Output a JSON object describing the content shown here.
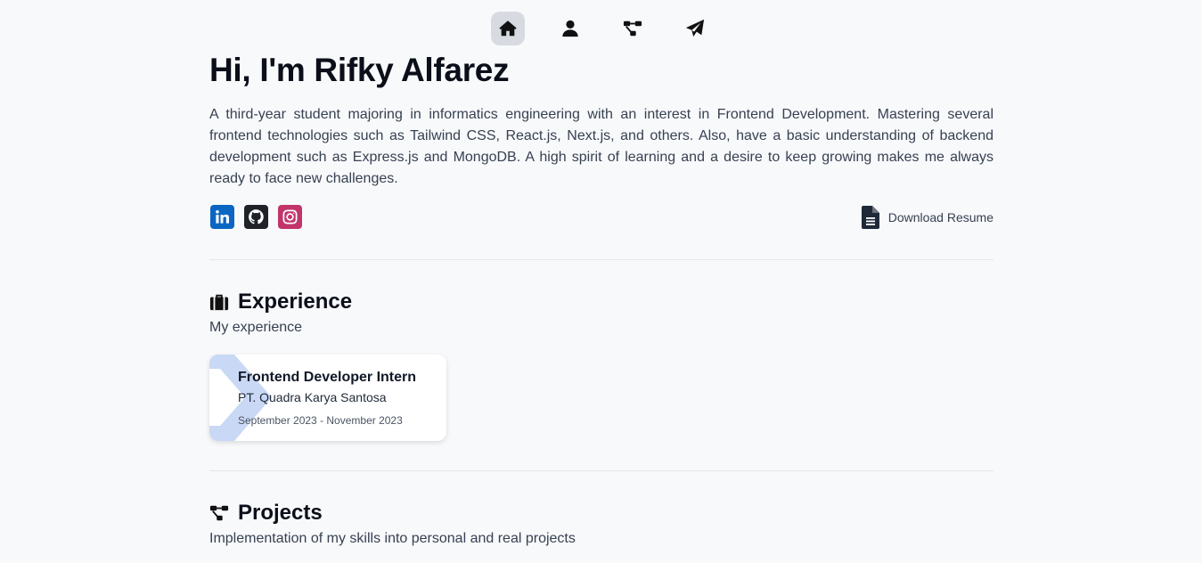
{
  "nav": {
    "items": [
      {
        "icon": "home-icon",
        "active": true
      },
      {
        "icon": "user-icon",
        "active": false
      },
      {
        "icon": "projects-icon",
        "active": false
      },
      {
        "icon": "send-icon",
        "active": false
      }
    ]
  },
  "hero": {
    "title": "Hi, I'm Rifky Alfarez",
    "description": "A third-year student majoring in informatics engineering with an interest in Frontend Development. Mastering several frontend technologies such as Tailwind CSS, React.js, Next.js, and others. Also, have a basic understanding of backend development such as Express.js and MongoDB. A high spirit of learning and a desire to keep growing makes me always ready to face new challenges.",
    "socials": [
      {
        "icon": "linkedin-icon",
        "color": "#0a66c2"
      },
      {
        "icon": "github-icon",
        "color": "#1f2328"
      },
      {
        "icon": "instagram-icon",
        "color": "#c1356b"
      }
    ],
    "download_label": "Download Resume"
  },
  "experience": {
    "title": "Experience",
    "subtitle": "My experience",
    "items": [
      {
        "role": "Frontend Developer Intern",
        "company": "PT. Quadra Karya Santosa",
        "period": "September 2023 - November 2023"
      }
    ]
  },
  "projects": {
    "title": "Projects",
    "subtitle": "Implementation of my skills into personal and real projects"
  },
  "colors": {
    "background": "#f8f9fb",
    "active_nav": "#d7dbe1",
    "text_dark": "#0b0f19",
    "text_body": "#374151",
    "card_accent": "#c9d8f5"
  }
}
